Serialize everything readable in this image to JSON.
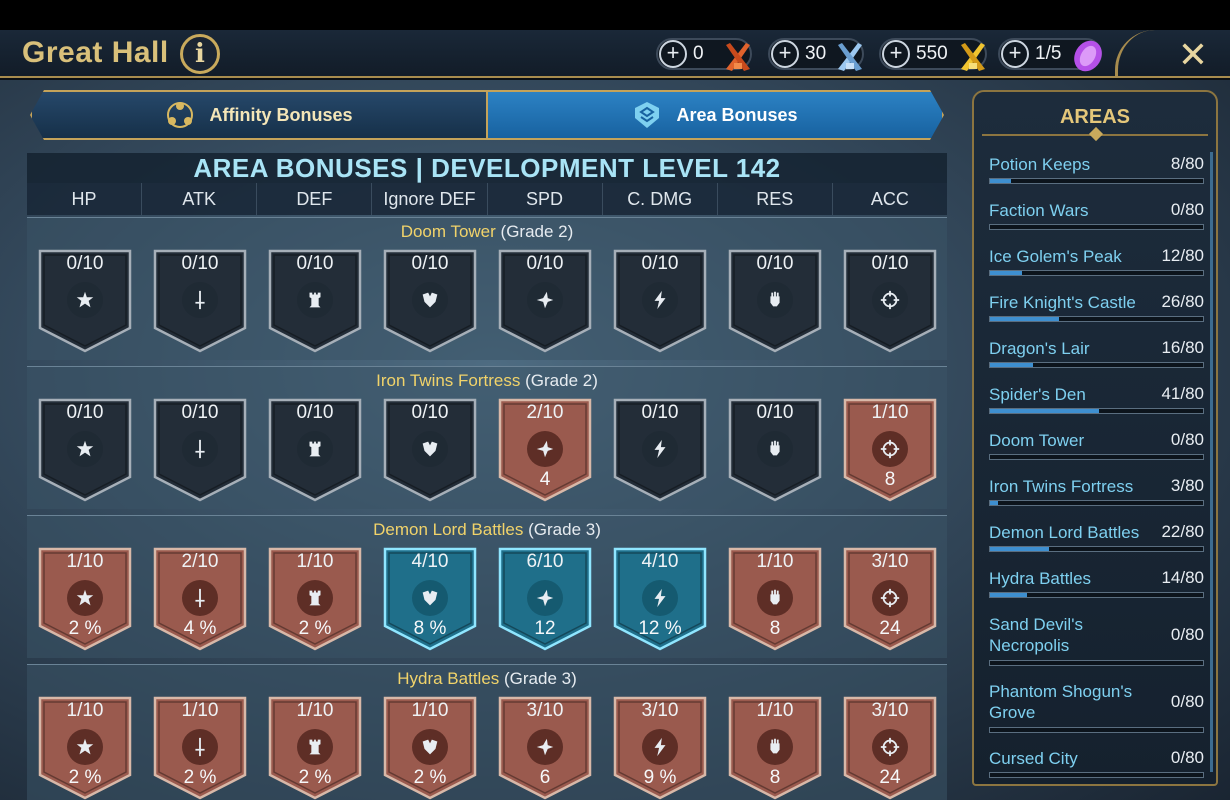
{
  "header": {
    "title": "Great Hall",
    "info_label": "i",
    "close_label": "✕",
    "resources": [
      {
        "value": "0",
        "icon": "red-sword-icon",
        "color": "#e0622c"
      },
      {
        "value": "30",
        "icon": "blue-sword-icon",
        "color": "#7fb4e8"
      },
      {
        "value": "550",
        "icon": "gold-sword-icon",
        "color": "#e7b321"
      },
      {
        "value": "1/5",
        "icon": "purple-gem-icon",
        "color": "#b550e8"
      }
    ]
  },
  "tabs": [
    {
      "label": "Affinity Bonuses",
      "active": false
    },
    {
      "label": "Area Bonuses",
      "active": true
    }
  ],
  "banner": "AREA BONUSES | DEVELOPMENT LEVEL 142",
  "columns": [
    "HP",
    "ATK",
    "DEF",
    "Ignore DEF",
    "SPD",
    "C. DMG",
    "RES",
    "ACC"
  ],
  "column_icons": [
    "hp-icon",
    "atk-icon",
    "def-icon",
    "ignore-def-icon",
    "spd-icon",
    "crit-dmg-icon",
    "res-icon",
    "acc-icon"
  ],
  "sections": [
    {
      "area": "Doom Tower",
      "grade": "(Grade 2)",
      "cells": [
        {
          "progress": "0/10",
          "bonus": "",
          "style": "dark"
        },
        {
          "progress": "0/10",
          "bonus": "",
          "style": "dark"
        },
        {
          "progress": "0/10",
          "bonus": "",
          "style": "dark"
        },
        {
          "progress": "0/10",
          "bonus": "",
          "style": "dark"
        },
        {
          "progress": "0/10",
          "bonus": "",
          "style": "dark"
        },
        {
          "progress": "0/10",
          "bonus": "",
          "style": "dark"
        },
        {
          "progress": "0/10",
          "bonus": "",
          "style": "dark"
        },
        {
          "progress": "0/10",
          "bonus": "",
          "style": "dark"
        }
      ]
    },
    {
      "area": "Iron Twins Fortress",
      "grade": "(Grade 2)",
      "cells": [
        {
          "progress": "0/10",
          "bonus": "",
          "style": "dark"
        },
        {
          "progress": "0/10",
          "bonus": "",
          "style": "dark"
        },
        {
          "progress": "0/10",
          "bonus": "",
          "style": "dark"
        },
        {
          "progress": "0/10",
          "bonus": "",
          "style": "dark"
        },
        {
          "progress": "2/10",
          "bonus": "4",
          "style": "rust"
        },
        {
          "progress": "0/10",
          "bonus": "",
          "style": "dark"
        },
        {
          "progress": "0/10",
          "bonus": "",
          "style": "dark"
        },
        {
          "progress": "1/10",
          "bonus": "8",
          "style": "rust"
        }
      ]
    },
    {
      "area": "Demon Lord Battles",
      "grade": "(Grade 3)",
      "cells": [
        {
          "progress": "1/10",
          "bonus": "2 %",
          "style": "rust"
        },
        {
          "progress": "2/10",
          "bonus": "4 %",
          "style": "rust"
        },
        {
          "progress": "1/10",
          "bonus": "2 %",
          "style": "rust"
        },
        {
          "progress": "4/10",
          "bonus": "8 %",
          "style": "blue"
        },
        {
          "progress": "6/10",
          "bonus": "12",
          "style": "blue"
        },
        {
          "progress": "4/10",
          "bonus": "12 %",
          "style": "blue"
        },
        {
          "progress": "1/10",
          "bonus": "8",
          "style": "rust"
        },
        {
          "progress": "3/10",
          "bonus": "24",
          "style": "rust"
        }
      ]
    },
    {
      "area": "Hydra Battles",
      "grade": "(Grade 3)",
      "cells": [
        {
          "progress": "1/10",
          "bonus": "2 %",
          "style": "rust"
        },
        {
          "progress": "1/10",
          "bonus": "2 %",
          "style": "rust"
        },
        {
          "progress": "1/10",
          "bonus": "2 %",
          "style": "rust"
        },
        {
          "progress": "1/10",
          "bonus": "2 %",
          "style": "rust"
        },
        {
          "progress": "3/10",
          "bonus": "6",
          "style": "rust"
        },
        {
          "progress": "3/10",
          "bonus": "9 %",
          "style": "rust"
        },
        {
          "progress": "1/10",
          "bonus": "8",
          "style": "rust"
        },
        {
          "progress": "3/10",
          "bonus": "24",
          "style": "rust"
        }
      ]
    }
  ],
  "areas_panel": {
    "title": "AREAS",
    "items": [
      {
        "name": "Potion Keeps",
        "count": "8/80",
        "fraction": 0.1
      },
      {
        "name": "Faction Wars",
        "count": "0/80",
        "fraction": 0
      },
      {
        "name": "Ice Golem's Peak",
        "count": "12/80",
        "fraction": 0.15
      },
      {
        "name": "Fire Knight's Castle",
        "count": "26/80",
        "fraction": 0.325
      },
      {
        "name": "Dragon's Lair",
        "count": "16/80",
        "fraction": 0.2
      },
      {
        "name": "Spider's Den",
        "count": "41/80",
        "fraction": 0.5125
      },
      {
        "name": "Doom Tower",
        "count": "0/80",
        "fraction": 0
      },
      {
        "name": "Iron Twins Fortress",
        "count": "3/80",
        "fraction": 0.0375
      },
      {
        "name": "Demon Lord Battles",
        "count": "22/80",
        "fraction": 0.275
      },
      {
        "name": "Hydra Battles",
        "count": "14/80",
        "fraction": 0.175
      },
      {
        "name": "Sand Devil's Necropolis",
        "count": "0/80",
        "fraction": 0
      },
      {
        "name": "Phantom Shogun's Grove",
        "count": "0/80",
        "fraction": 0
      },
      {
        "name": "Cursed City",
        "count": "0/80",
        "fraction": 0
      }
    ]
  }
}
